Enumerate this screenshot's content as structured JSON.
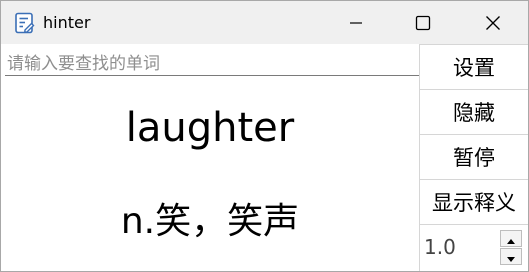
{
  "window": {
    "title": "hinter",
    "icon": "notepad-icon",
    "controls": [
      "minimize-icon",
      "maximize-icon",
      "close-icon"
    ]
  },
  "search": {
    "placeholder": "请输入要查找的单词",
    "value": ""
  },
  "entry": {
    "word": "laughter",
    "meaning": "n.笑，笑声"
  },
  "buttons": {
    "settings": "设置",
    "hide": "隐藏",
    "pause": "暂停",
    "show_meaning": "显示释义"
  },
  "spinner": {
    "value": "1.0"
  }
}
